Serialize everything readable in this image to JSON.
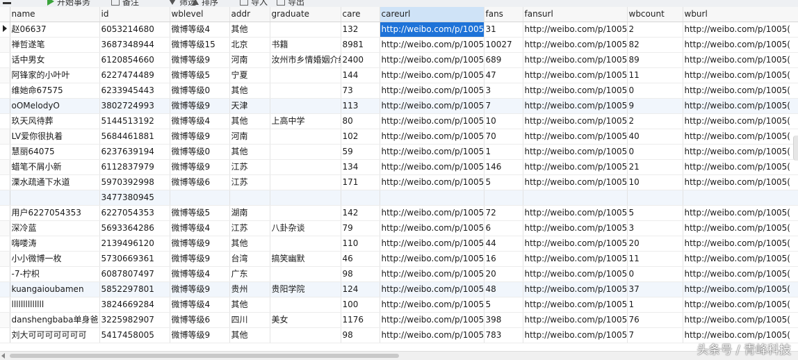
{
  "toolbar": {
    "items": [
      {
        "label": "开始事务",
        "icon": "play-icon"
      },
      {
        "label": "备注",
        "icon": "note-icon"
      },
      {
        "label": "筛选",
        "icon": "filter-icon"
      },
      {
        "label": "排序",
        "icon": "sort-icon"
      },
      {
        "label": "导入",
        "icon": "import-icon"
      },
      {
        "label": "导出",
        "icon": "export-icon"
      }
    ]
  },
  "table": {
    "columns": [
      "name",
      "id",
      "wblevel",
      "addr",
      "graduate",
      "care",
      "careurl",
      "fans",
      "fansurl",
      "wbcount",
      "wburl"
    ],
    "rows": [
      [
        "赵06637",
        "6053214680",
        "微博等级4",
        "其他",
        "",
        "132",
        "http://weibo.com/p/1005(",
        "31",
        "http://weibo.com/p/1005(",
        "2",
        "http://weibo.com/p/1005("
      ],
      [
        "禅哲遂笔",
        "3687348944",
        "微博等级15",
        "北京",
        "书籍",
        "8981",
        "http://weibo.com/p/1005(",
        "10027",
        "http://weibo.com/p/1005(",
        "82",
        "http://weibo.com/p/1005("
      ],
      [
        "话中男女",
        "6120854660",
        "微博等级9",
        "河南",
        "汝州市乡情婚姻介绍",
        "2400",
        "http://weibo.com/p/1005(",
        "689",
        "http://weibo.com/p/1005(",
        "89",
        "http://weibo.com/p/1005("
      ],
      [
        "阿锋家的小叶叶",
        "6227474489",
        "微博等级5",
        "宁夏",
        "",
        "144",
        "http://weibo.com/p/1005(",
        "47",
        "http://weibo.com/p/1005(",
        "11",
        "http://weibo.com/p/1005("
      ],
      [
        "维她命67575",
        "6233945443",
        "微博等级0",
        "其他",
        "",
        "73",
        "http://weibo.com/p/1005(",
        "3",
        "http://weibo.com/p/1005(",
        "0",
        "http://weibo.com/p/1005("
      ],
      [
        "oOMelodyO",
        "3802724993",
        "微博等级9",
        "天津",
        "",
        "113",
        "http://weibo.com/p/1005(",
        "7",
        "http://weibo.com/p/1005(",
        "9",
        "http://weibo.com/p/1005("
      ],
      [
        "玖天风待葬",
        "5144513192",
        "微博等级4",
        "其他",
        "上高中学",
        "80",
        "http://weibo.com/p/1005(",
        "10",
        "http://weibo.com/p/1005(",
        "2",
        "http://weibo.com/p/1005("
      ],
      [
        "LV爱你很执着",
        "5684461881",
        "微博等级9",
        "河南",
        "",
        "102",
        "http://weibo.com/p/1005(",
        "70",
        "http://weibo.com/p/1005(",
        "40",
        "http://weibo.com/p/1005("
      ],
      [
        "慧丽64075",
        "6237639194",
        "微博等级0",
        "其他",
        "",
        "59",
        "http://weibo.com/p/1005(",
        "1",
        "http://weibo.com/p/1005(",
        "0",
        "http://weibo.com/p/1005("
      ],
      [
        "蜡笔不屑小新",
        "6112837979",
        "微博等级9",
        "江苏",
        "",
        "134",
        "http://weibo.com/p/1005(",
        "146",
        "http://weibo.com/p/1005(",
        "21",
        "http://weibo.com/p/1005("
      ],
      [
        "溧水疏通下水道",
        "5970392998",
        "微博等级6",
        "江苏",
        "",
        "171",
        "http://weibo.com/p/1005(",
        "5",
        "http://weibo.com/p/1005(",
        "10",
        "http://weibo.com/p/1005("
      ],
      [
        "",
        "3477380945",
        "",
        "",
        "",
        "",
        "",
        "",
        "",
        "",
        ""
      ],
      [
        "用户6227054353",
        "6227054353",
        "微博等级5",
        "湖南",
        "",
        "142",
        "http://weibo.com/p/1005(",
        "72",
        "http://weibo.com/p/1005(",
        "5",
        "http://weibo.com/p/1005("
      ],
      [
        "深冷蓝",
        "5693364286",
        "微博等级4",
        "江苏",
        "八卦杂谈",
        "79",
        "http://weibo.com/p/1005(",
        "6",
        "http://weibo.com/p/1005(",
        "3",
        "http://weibo.com/p/1005("
      ],
      [
        "嗨喽涛",
        "2139496120",
        "微博等级9",
        "其他",
        "",
        "110",
        "http://weibo.com/p/1005(",
        "44",
        "http://weibo.com/p/1005(",
        "20",
        "http://weibo.com/p/1005("
      ],
      [
        "小小微博一枚",
        "5730669361",
        "微博等级9",
        "台湾",
        "搞笑幽默",
        "46",
        "http://weibo.com/p/1005(",
        "16",
        "http://weibo.com/p/1005(",
        "11",
        "http://weibo.com/p/1005("
      ],
      [
        "-7-柠枳",
        "6087807497",
        "微博等级4",
        "广东",
        "",
        "98",
        "http://weibo.com/p/1005(",
        "20",
        "http://weibo.com/p/1005(",
        "0",
        "http://weibo.com/p/1005("
      ],
      [
        "kuangaioubamen",
        "5852297801",
        "微博等级9",
        "贵州",
        "贵阳学院",
        "124",
        "http://weibo.com/p/1005(",
        "48",
        "http://weibo.com/p/1005(",
        "37",
        "http://weibo.com/p/1005("
      ],
      [
        "llllllllllllll",
        "3824669284",
        "微博等级4",
        "其他",
        "",
        "100",
        "http://weibo.com/p/1005(",
        "5",
        "http://weibo.com/p/1005(",
        "1",
        "http://weibo.com/p/1005("
      ],
      [
        "danshengbaba单身爸",
        "3225982907",
        "微博等级6",
        "四川",
        "美女",
        "1176",
        "http://weibo.com/p/1005(",
        "398",
        "http://weibo.com/p/1005(",
        "76",
        "http://weibo.com/p/1005("
      ],
      [
        "刘大可可可可可可可",
        "5417458005",
        "微博等级9",
        "其他",
        "",
        "98",
        "http://weibo.com/p/1005(",
        "783",
        "http://weibo.com/p/1005(",
        "7",
        "http://weibo.com/p/1005("
      ]
    ],
    "current_row": 0,
    "selected_column": "careurl"
  },
  "watermark": "头条号 / 青峰科技",
  "colors": {
    "selection": "#1e73d8",
    "header_selected": "#cfe3f7",
    "alt_row": "#f1f6fc"
  }
}
